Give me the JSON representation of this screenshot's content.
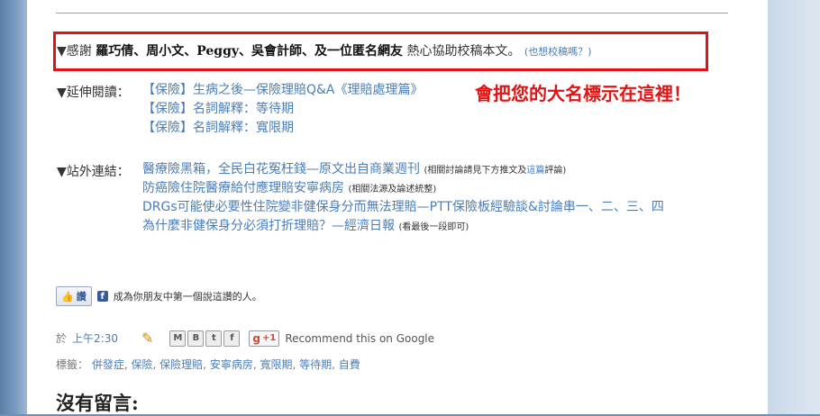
{
  "thanks": {
    "prefix": "▼感謝",
    "names": "羅巧倩、周小文、Peggy、吳會計師、及一位匿名網友",
    "suffix": "熱心協助校稿本文。",
    "small_link": "(也想校稿嗎？)"
  },
  "extended_reading": {
    "label": "▼延伸閱讀：",
    "links": [
      "【保險】生病之後—保險理賠Q&A《理賠處理篇》",
      "【保險】名詞解釋：等待期",
      "【保險】名詞解釋：寬限期"
    ]
  },
  "callout": "會把您的大名標示在這裡！",
  "external_links": {
    "label": "▼站外連結：",
    "items": [
      {
        "text": "醫療險黑箱，全民白花冤枉錢—原文出自商業週刊",
        "note_pre": "(相關討論請見下方推文及",
        "note_link": "這篇",
        "note_post": "評論)"
      },
      {
        "text": "防癌險住院醫療給付應理賠安寧病房",
        "note_pre": "(相關法源及論述統整)",
        "note_link": "",
        "note_post": ""
      },
      {
        "text": "DRGs可能使必要性住院變非健保身分而無法理賠—PTT保險板經驗談&討論串一、二、三、四",
        "note_pre": "",
        "note_link": "",
        "note_post": ""
      },
      {
        "text": "為什麼非健保身分必須打折理賠？—經濟日報",
        "note_pre": "(看最後一段即可)",
        "note_link": "",
        "note_post": ""
      }
    ]
  },
  "like": {
    "button_label": "讚",
    "text": "成為你朋友中第一個說這讚的人。"
  },
  "meta": {
    "posted_prefix": "於",
    "time": "上午2:30",
    "share_buttons": [
      "M",
      "B",
      "t",
      "f"
    ],
    "plus_one": "+1",
    "recommend": "Recommend this on Google"
  },
  "labels": {
    "prefix": "標籤：",
    "items": [
      "併發症",
      "保險",
      "保險理賠",
      "安寧病房",
      "寬限期",
      "等待期",
      "自費"
    ]
  },
  "comments_title": "沒有留言:"
}
